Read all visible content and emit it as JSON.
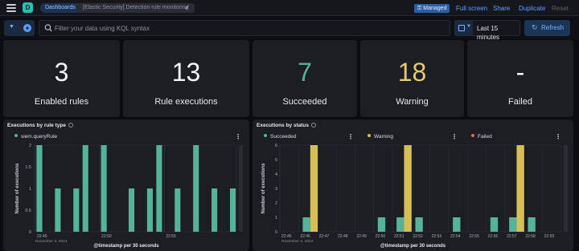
{
  "header": {
    "space_initial": "D",
    "breadcrumbs": [
      "Dashboards",
      "[Elastic Security] Detection rule monitoring"
    ],
    "managed_badge": "Managed",
    "actions": [
      "Full screen",
      "Share",
      "Duplicate",
      "Reset"
    ]
  },
  "query": {
    "placeholder": "Filter your data using KQL syntax",
    "time_range": "Last 15 minutes",
    "refresh_label": "Refresh"
  },
  "metrics": [
    {
      "value": "3",
      "label": "Enabled rules",
      "color": "#f2f4f7"
    },
    {
      "value": "13",
      "label": "Rule executions",
      "color": "#f2f4f7"
    },
    {
      "value": "7",
      "label": "Succeeded",
      "color": "#54b399"
    },
    {
      "value": "18",
      "label": "Warning",
      "color": "#e6c86e"
    },
    {
      "value": "-",
      "label": "Failed",
      "color": "#f2f4f7"
    }
  ],
  "colors": {
    "succeeded": "#54b399",
    "warning": "#d6bf57",
    "failed": "#e7664c",
    "accent": "#5aa0ff"
  },
  "chart_data": [
    {
      "type": "bar",
      "title": "Executions by rule type",
      "series": [
        {
          "name": "siem.queryRule",
          "values": [
            2,
            0,
            1,
            0,
            1,
            2,
            0,
            2,
            0,
            0,
            1,
            0,
            1,
            2,
            0,
            1,
            0,
            2,
            0,
            1,
            0,
            1
          ]
        }
      ],
      "x_ticks": [
        "22:45",
        "22:50",
        "22:55"
      ],
      "x_date": "November 3, 2024",
      "xlabel": "@timestamp per 30 seconds",
      "ylabel": "Number of executions",
      "y_ticks": [
        "0",
        "0.5",
        "1",
        "1.5",
        "2"
      ],
      "ylim": [
        0,
        2
      ]
    },
    {
      "type": "bar",
      "title": "Executions by status",
      "categories": [
        "22:45",
        "22:46",
        "22:47",
        "22:48",
        "22:49",
        "22:50",
        "22:51",
        "22:52",
        "22:53",
        "22:54",
        "22:55",
        "22:56",
        "22:57",
        "22:58",
        "22:59"
      ],
      "series": [
        {
          "name": "Succeeded",
          "values": [
            0,
            1,
            0,
            0,
            0,
            1,
            1,
            1,
            0,
            1,
            0,
            1,
            1,
            1,
            0
          ]
        },
        {
          "name": "Warning",
          "values": [
            0,
            6,
            0,
            0,
            0,
            0,
            6,
            0,
            0,
            0,
            0,
            0,
            6,
            0,
            0
          ]
        },
        {
          "name": "Failed",
          "values": []
        }
      ],
      "x_date": "November 3, 2024",
      "xlabel": "@timestamp per 30 seconds",
      "ylabel": "Number of executions",
      "y_ticks": [
        "0",
        "1",
        "2",
        "3",
        "4",
        "5",
        "6"
      ],
      "ylim": [
        0,
        6
      ]
    }
  ]
}
